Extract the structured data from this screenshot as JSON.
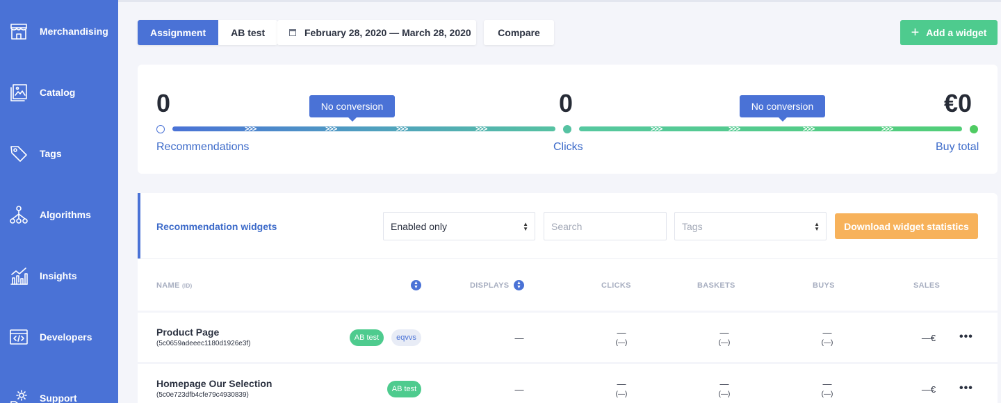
{
  "sidebar": {
    "items": [
      {
        "label": "Merchandising",
        "icon": "store-icon"
      },
      {
        "label": "Catalog",
        "icon": "catalog-icon"
      },
      {
        "label": "Tags",
        "icon": "tag-icon"
      },
      {
        "label": "Algorithms",
        "icon": "algorithm-icon"
      },
      {
        "label": "Insights",
        "icon": "insights-icon"
      },
      {
        "label": "Developers",
        "icon": "code-icon"
      },
      {
        "label": "Support",
        "icon": "support-gear-icon"
      }
    ]
  },
  "toolbar": {
    "tab_assignment": "Assignment",
    "tab_abtest": "AB test",
    "date_range": "February 28, 2020 — March 28, 2020",
    "compare_label": "Compare",
    "add_widget_label": "Add a widget"
  },
  "funnel": {
    "recommendations_value": "0",
    "recommendations_label": "Recommendations",
    "clicks_value": "0",
    "clicks_label": "Clicks",
    "buy_total_value": "€0",
    "buy_total_label": "Buy total",
    "tooltip_1": "No conversion",
    "tooltip_2": "No conversion"
  },
  "widgets": {
    "title": "Recommendation widgets",
    "filter_value": "Enabled only",
    "search_placeholder": "Search",
    "tags_placeholder": "Tags",
    "download_label": "Download widget statistics",
    "columns": {
      "name": "NAME",
      "id": "(ID)",
      "displays": "DISPLAYS",
      "clicks": "CLICKS",
      "baskets": "BASKETS",
      "buys": "BUYS",
      "sales": "SALES"
    },
    "rows": [
      {
        "name": "Product Page",
        "id": "(5c0659adeeec1180d1926e3f)",
        "badges": [
          "AB test",
          "eqvvs"
        ],
        "displays": "—",
        "clicks": "—",
        "clicks_sub": "(—)",
        "baskets": "—",
        "baskets_sub": "(—)",
        "buys": "—",
        "buys_sub": "(—)",
        "sales": "—€"
      },
      {
        "name": "Homepage Our Selection",
        "id": "(5c0e723dfb4cfe79c4930839)",
        "badges": [
          "AB test"
        ],
        "displays": "—",
        "clicks": "—",
        "clicks_sub": "(—)",
        "baskets": "—",
        "baskets_sub": "(—)",
        "buys": "—",
        "buys_sub": "(—)",
        "sales": "—€"
      }
    ]
  },
  "colors": {
    "sidebar": "#4a72d6",
    "primary": "#4a72d6",
    "success": "#4ecb8e",
    "warning": "#f7b25b"
  }
}
